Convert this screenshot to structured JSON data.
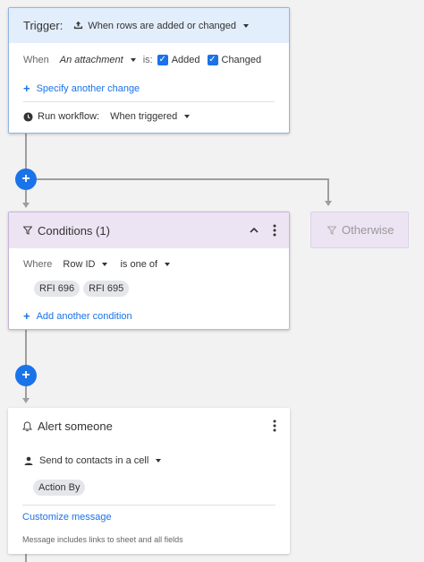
{
  "trigger": {
    "title": "Trigger:",
    "event": "When rows are added or changed",
    "when_label": "When",
    "field": "An attachment",
    "is_label": "is:",
    "added_label": "Added",
    "changed_label": "Changed",
    "added_checked": true,
    "changed_checked": true,
    "specify_link": "Specify another change",
    "run_label": "Run workflow:",
    "run_value": "When triggered"
  },
  "conditions": {
    "title": "Conditions (1)",
    "where_label": "Where",
    "field": "Row ID",
    "operator": "is one of",
    "chips": [
      "RFI 696",
      "RFI 695"
    ],
    "add_link": "Add another condition"
  },
  "otherwise": {
    "title": "Otherwise"
  },
  "alert": {
    "title": "Alert someone",
    "send_to": "Send to contacts in a cell",
    "chip": "Action By",
    "customize_link": "Customize message",
    "note": "Message includes links to sheet and all fields"
  },
  "plus_symbol": "+",
  "colors": {
    "accent": "#1a73e8",
    "trigger_header_bg": "#e3eefc",
    "conditions_header_bg": "#ede4f3",
    "connector": "#9e9e9e"
  }
}
